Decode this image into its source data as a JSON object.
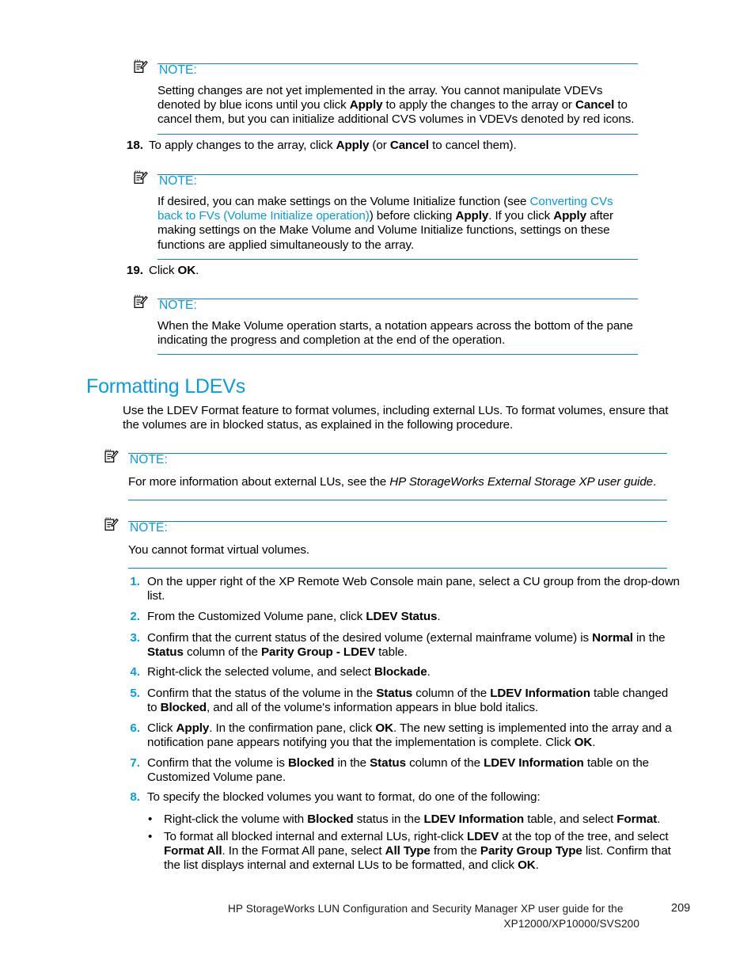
{
  "colors": {
    "accent": "#0d9ad8",
    "rule": "#1082bd",
    "link": "#0b9ad6",
    "text": "#000000"
  },
  "notes": {
    "label": "NOTE:",
    "icon": "note-pad-pencil-icon",
    "note1": {
      "p1_a": "Setting changes are not yet implemented in the array.  You cannot manipulate VDEVs denoted by blue icons until you click ",
      "p1_b": "Apply",
      "p1_c": " to apply the changes to the array or ",
      "p1_d": "Cancel",
      "p1_e": " to cancel them, but you can initialize additional CVS volumes in VDEVs denoted by red icons."
    },
    "note2": {
      "p_a": "If desired, you can make settings on the Volume Initialize function (see ",
      "link": "Converting CVs back to FVs (Volume Initialize operation)",
      "p_b": ") before clicking ",
      "p_c": "Apply",
      "p_d": ". If you click ",
      "p_e": "Apply",
      "p_f": " after making settings on the Make Volume and Volume Initialize functions, settings on these functions are applied simultaneously to the array."
    },
    "note3": {
      "p": "When the Make Volume operation starts, a notation appears across the bottom of the pane indicating the progress and completion at the end of the operation."
    },
    "note4": {
      "p_a": "For more information about external LUs, see the ",
      "p_italic": "HP StorageWorks External Storage XP user guide",
      "p_b": "."
    },
    "note5": {
      "p": "You cannot format virtual volumes."
    }
  },
  "steps_top": [
    {
      "num": "18.",
      "a": "To apply changes to the array, click ",
      "b1": "Apply",
      "c": " (or ",
      "b2": "Cancel",
      "d": " to cancel them)."
    },
    {
      "num": "19.",
      "a": "Click ",
      "b1": "OK",
      "c": "."
    }
  ],
  "section": {
    "heading": "Formatting LDEVs",
    "intro": "Use the LDEV Format feature to format volumes, including external LUs.  To format volumes, ensure that the volumes are in blocked status, as explained in the following procedure."
  },
  "procedure": [
    {
      "num": "1.",
      "parts": [
        {
          "t": "On the upper right of the XP Remote Web Console main pane, select a CU group from the drop-down list.",
          "s": "n"
        }
      ]
    },
    {
      "num": "2.",
      "parts": [
        {
          "t": "From the Customized Volume pane, click ",
          "s": "n"
        },
        {
          "t": "LDEV Status",
          "s": "b"
        },
        {
          "t": ".",
          "s": "n"
        }
      ]
    },
    {
      "num": "3.",
      "parts": [
        {
          "t": "Confirm that the current status of the desired volume (external mainframe volume) is ",
          "s": "n"
        },
        {
          "t": "Normal",
          "s": "b"
        },
        {
          "t": " in the ",
          "s": "n"
        },
        {
          "t": "Status",
          "s": "b"
        },
        {
          "t": " column of the ",
          "s": "n"
        },
        {
          "t": "Parity Group - LDEV",
          "s": "b"
        },
        {
          "t": " table.",
          "s": "n"
        }
      ]
    },
    {
      "num": "4.",
      "parts": [
        {
          "t": "Right-click the selected volume, and select ",
          "s": "n"
        },
        {
          "t": "Blockade",
          "s": "b"
        },
        {
          "t": ".",
          "s": "n"
        }
      ]
    },
    {
      "num": "5.",
      "parts": [
        {
          "t": "Confirm that the status of the volume in the ",
          "s": "n"
        },
        {
          "t": "Status",
          "s": "b"
        },
        {
          "t": " column of the ",
          "s": "n"
        },
        {
          "t": "LDEV Information",
          "s": "b"
        },
        {
          "t": " table changed to ",
          "s": "n"
        },
        {
          "t": "Blocked",
          "s": "b"
        },
        {
          "t": ", and all of the volume's information appears in blue bold italics.",
          "s": "n"
        }
      ]
    },
    {
      "num": "6.",
      "parts": [
        {
          "t": "Click ",
          "s": "n"
        },
        {
          "t": "Apply",
          "s": "b"
        },
        {
          "t": ". In the confirmation pane, click ",
          "s": "n"
        },
        {
          "t": "OK",
          "s": "b"
        },
        {
          "t": ". The new setting is implemented into the array and a notification pane appears notifying you that the implementation is complete.  Click ",
          "s": "n"
        },
        {
          "t": "OK",
          "s": "b"
        },
        {
          "t": ".",
          "s": "n"
        }
      ]
    },
    {
      "num": "7.",
      "parts": [
        {
          "t": "Confirm that the volume is ",
          "s": "n"
        },
        {
          "t": "Blocked",
          "s": "b"
        },
        {
          "t": " in the ",
          "s": "n"
        },
        {
          "t": "Status",
          "s": "b"
        },
        {
          "t": " column of the ",
          "s": "n"
        },
        {
          "t": "LDEV Information",
          "s": "b"
        },
        {
          "t": " table on the Customized Volume pane.",
          "s": "n"
        }
      ]
    },
    {
      "num": "8.",
      "parts": [
        {
          "t": "To specify the blocked volumes you want to format, do one of the following:",
          "s": "n"
        }
      ]
    }
  ],
  "bullets": [
    {
      "dot": "•",
      "parts": [
        {
          "t": "Right-click the volume with ",
          "s": "n"
        },
        {
          "t": "Blocked",
          "s": "b"
        },
        {
          "t": " status in the ",
          "s": "n"
        },
        {
          "t": "LDEV Information",
          "s": "b"
        },
        {
          "t": " table, and select ",
          "s": "n"
        },
        {
          "t": "Format",
          "s": "b"
        },
        {
          "t": ".",
          "s": "n"
        }
      ]
    },
    {
      "dot": "•",
      "parts": [
        {
          "t": "To format all blocked internal and external LUs, right-click ",
          "s": "n"
        },
        {
          "t": "LDEV",
          "s": "b"
        },
        {
          "t": " at the top of the tree, and select ",
          "s": "n"
        },
        {
          "t": "Format All",
          "s": "b"
        },
        {
          "t": ".  In the Format All pane, select ",
          "s": "n"
        },
        {
          "t": "All Type",
          "s": "b"
        },
        {
          "t": " from the ",
          "s": "n"
        },
        {
          "t": "Parity Group Type",
          "s": "b"
        },
        {
          "t": " list.  Confirm that the list displays internal and external LUs to be formatted, and click ",
          "s": "n"
        },
        {
          "t": "OK",
          "s": "b"
        },
        {
          "t": ".",
          "s": "n"
        }
      ]
    }
  ],
  "footer": {
    "line1": "HP StorageWorks LUN Configuration and Security Manager XP user guide for the",
    "line2": "XP12000/XP10000/SVS200",
    "page_number": "209"
  }
}
